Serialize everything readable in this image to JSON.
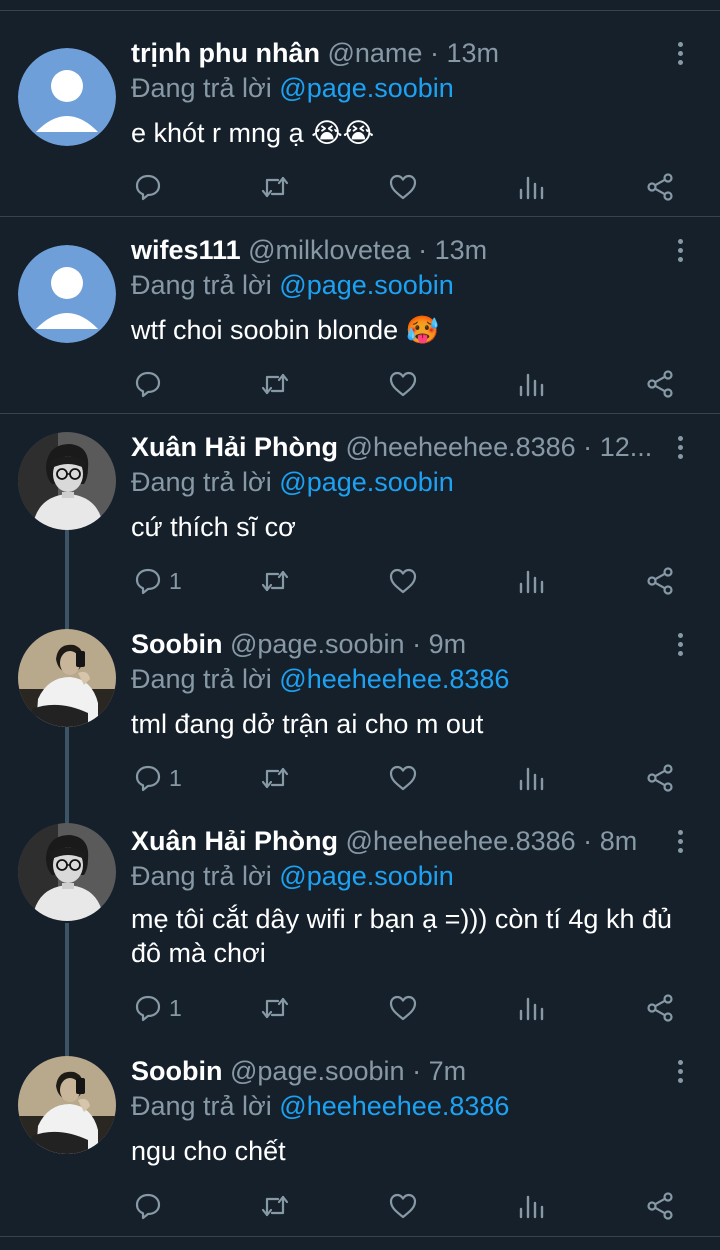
{
  "theme": {
    "background": "#15202b",
    "text": "#ffffff",
    "muted": "#8899a6",
    "link": "#1da1f2",
    "divider": "#38444d"
  },
  "reply_prefix": "Đang trả lời",
  "tweets": [
    {
      "name": "trịnh phu nhân",
      "handle": "@name",
      "sep": "·",
      "time": "13m",
      "reply_to": "@page.soobin",
      "text": "e khót r mng ạ 😭😭",
      "reply_count": "",
      "avatar": "default-avatar"
    },
    {
      "name": "wifes111",
      "handle": "@milklovetea",
      "sep": "·",
      "time": "13m",
      "reply_to": "@page.soobin",
      "text": "wtf choi soobin blonde 🥵",
      "reply_count": "",
      "avatar": "default-avatar"
    },
    {
      "name": "Xuân Hải Phòng",
      "handle": "@heeheehee.8386",
      "sep": "·",
      "time": "12...",
      "reply_to": "@page.soobin",
      "text": "cứ thích sĩ cơ",
      "reply_count": "1",
      "avatar": "photo-avatar-glasses"
    },
    {
      "name": "Soobin",
      "handle": "@page.soobin",
      "sep": "·",
      "time": "9m",
      "reply_to": "@heeheehee.8386",
      "text": "tml đang dở trận ai cho m out",
      "reply_count": "1",
      "avatar": "photo-avatar-selfie"
    },
    {
      "name": "Xuân Hải Phòng",
      "handle": "@heeheehee.8386",
      "sep": "·",
      "time": "8m",
      "reply_to": "@page.soobin",
      "text": "mẹ tôi cắt dây wifi r bạn ạ =))) còn tí 4g kh đủ đô mà chơi",
      "reply_count": "1",
      "avatar": "photo-avatar-glasses"
    },
    {
      "name": "Soobin",
      "handle": "@page.soobin",
      "sep": "·",
      "time": "7m",
      "reply_to": "@heeheehee.8386",
      "text": "ngu cho chết",
      "reply_count": "",
      "avatar": "photo-avatar-selfie"
    }
  ],
  "actions": {
    "reply_icon": "reply-icon",
    "retweet_icon": "retweet-icon",
    "like_icon": "like-icon",
    "analytics_icon": "analytics-icon",
    "share_icon": "share-icon"
  }
}
